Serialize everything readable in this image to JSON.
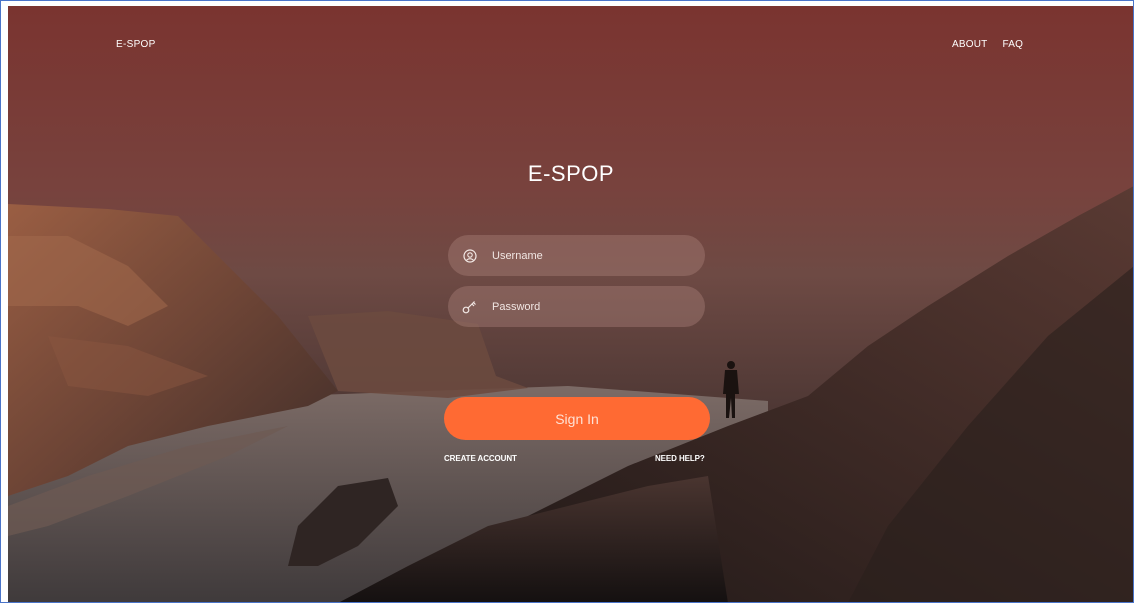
{
  "header": {
    "brand": "E-SPOP",
    "nav": [
      {
        "label": "ABOUT"
      },
      {
        "label": "FAQ"
      }
    ]
  },
  "login": {
    "title": "E-SPOP",
    "username": {
      "placeholder": "Username",
      "value": "",
      "icon": "user-circle-icon"
    },
    "password": {
      "placeholder": "Password",
      "value": "",
      "icon": "key-icon"
    },
    "sign_in_label": "Sign In",
    "create_account_label": "CREATE ACCOUNT",
    "need_help_label": "NEED HELP?"
  },
  "colors": {
    "accent": "#ff6a33",
    "overlay": "#7a3430",
    "text": "#ffffff"
  }
}
